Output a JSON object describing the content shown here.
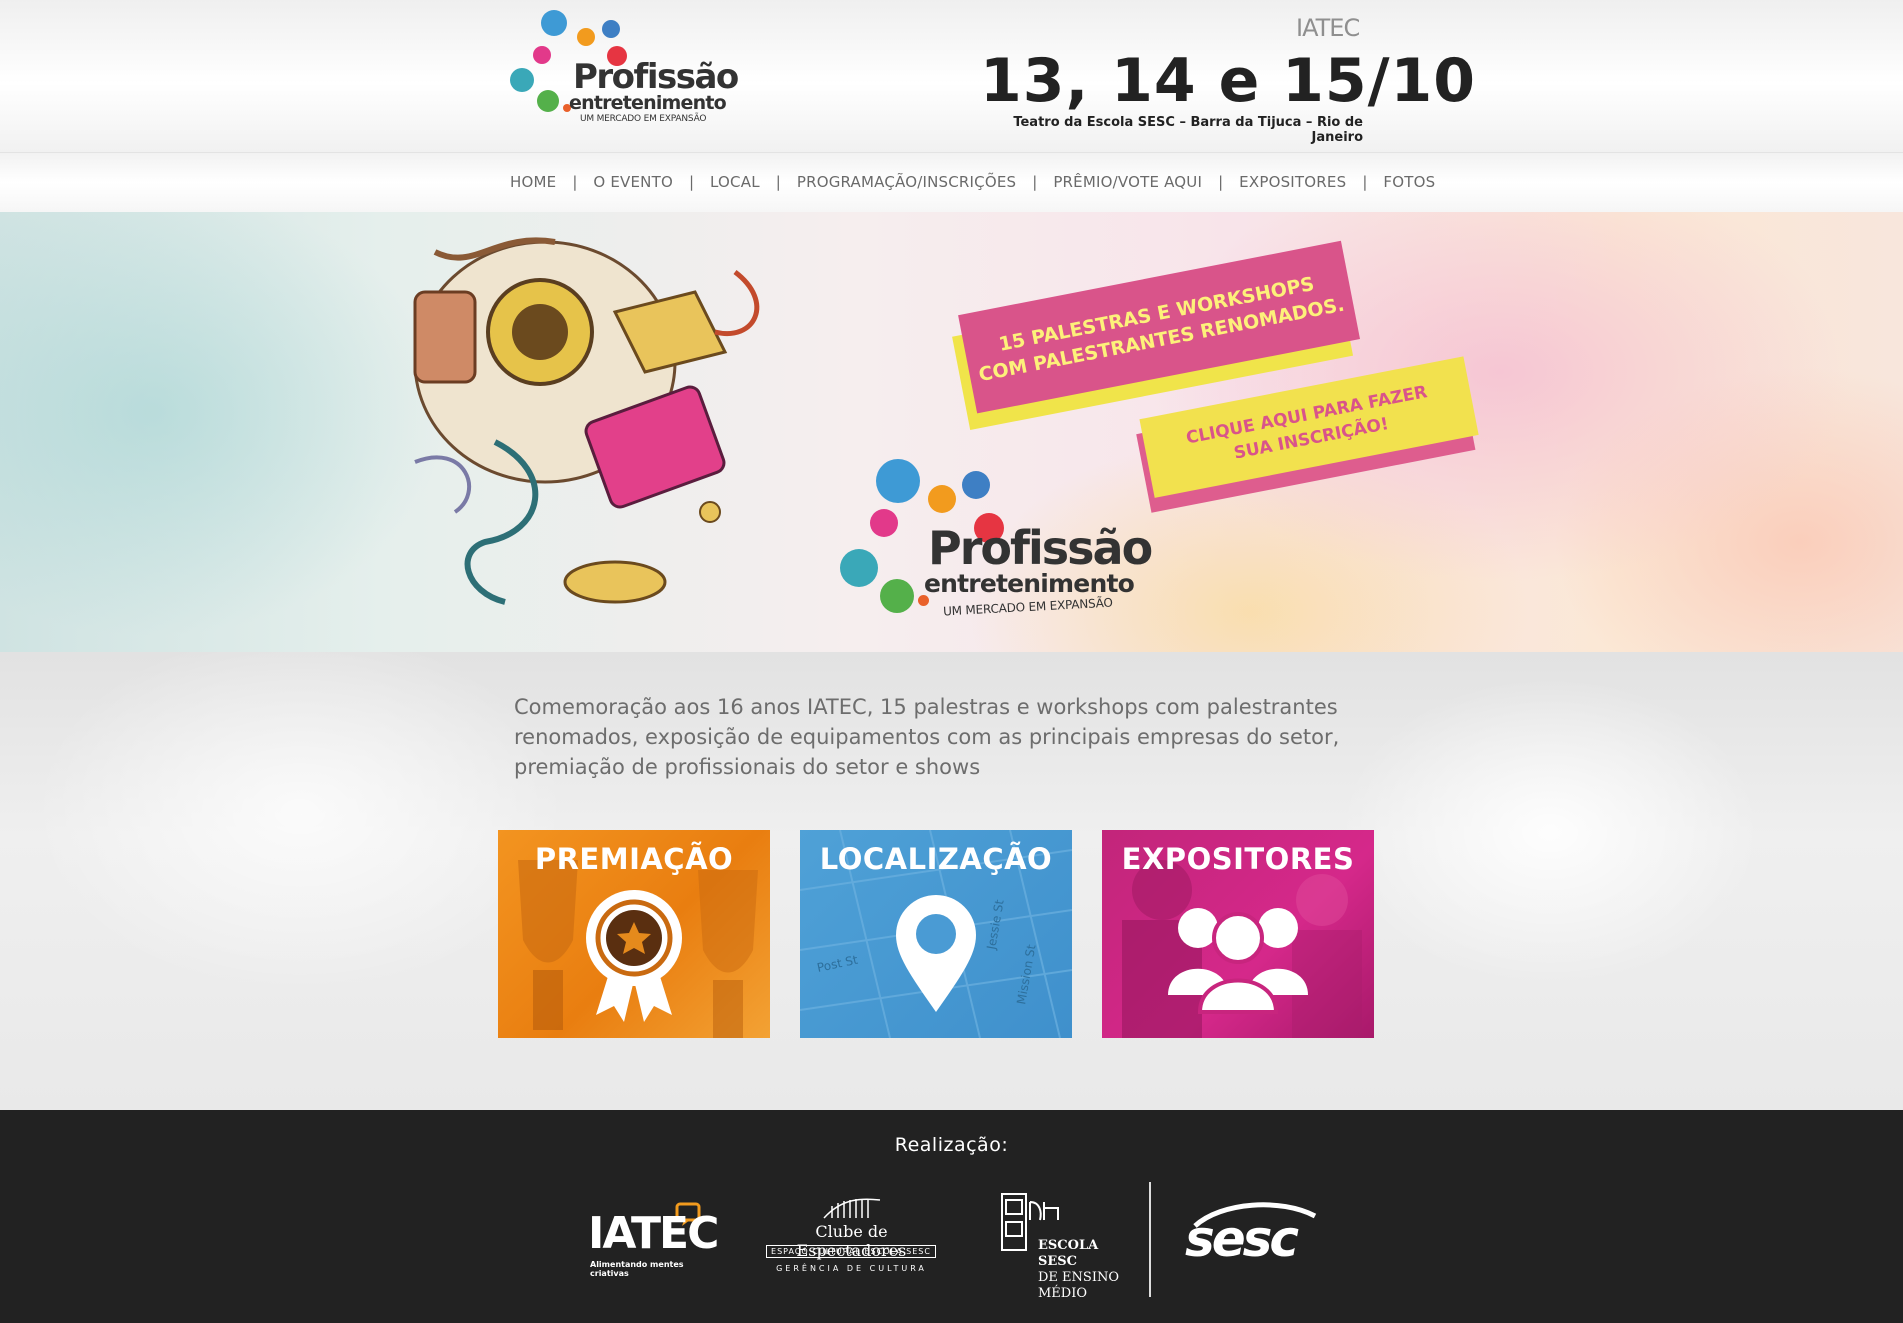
{
  "header": {
    "logo": {
      "word": "Profissão",
      "sub_dot": ".",
      "sub": "entretenimento",
      "tagline": "UM MERCADO EM EXPANSÃO"
    },
    "sponsor_small": {
      "name": "IATEC",
      "tagline": "Alimentando mentes criativas"
    },
    "dates": "13, 14 e 15/10",
    "venue": "Teatro da Escola SESC – Barra da Tijuca – Rio de Janeiro"
  },
  "nav": {
    "items": [
      {
        "label": "HOME"
      },
      {
        "label": "O EVENTO"
      },
      {
        "label": "LOCAL"
      },
      {
        "label": "PROGRAMAÇÃO/INSCRIÇÕES"
      },
      {
        "label": "PRÊMIO/VOTE AQUI"
      },
      {
        "label": "EXPOSITORES"
      },
      {
        "label": "FOTOS"
      }
    ],
    "separator": "|"
  },
  "banner": {
    "pink_line1": "15 PALESTRAS E WORKSHOPS",
    "pink_line2": "COM PALESTRANTES RENOMADOS.",
    "cta_line1": "CLIQUE AQUI PARA FAZER",
    "cta_line2": "SUA INSCRIÇÃO!",
    "logo": {
      "word": "Profissão",
      "sub_dot": ".",
      "sub": "entretenimento",
      "tagline": "UM MERCADO EM EXPANSÃO"
    }
  },
  "main": {
    "intro": "Comemoração aos 16 anos IATEC, 15 palestras e workshops com palestrantes renomados, exposição de equipamentos com as principais empresas do setor, premiação de profissionais do setor e shows",
    "cards": [
      {
        "title": "PREMIAÇÃO",
        "icon": "award-ribbon-icon",
        "color": "#f08a1c"
      },
      {
        "title": "LOCALIZAÇÃO",
        "icon": "map-pin-icon",
        "color": "#4a9bd4",
        "map_labels": [
          "Post St",
          "Mission St",
          "Jessie St"
        ]
      },
      {
        "title": "EXPOSITORES",
        "icon": "people-group-icon",
        "color": "#c8257e"
      }
    ]
  },
  "footer": {
    "heading": "Realização:",
    "logos": {
      "iatec": {
        "name": "IATEC",
        "tagline": "Alimentando mentes criativas"
      },
      "clube": {
        "title": "Clube de Espectadores",
        "line2": "ESPAÇO CULTURAL ESCOLA SESC",
        "line3": "GERÊNCIA DE CULTURA"
      },
      "escola": {
        "line1": "ESCOLA",
        "line2": "SESC",
        "line3": "DE ENSINO",
        "line4": "MÉDIO"
      },
      "sesc": {
        "name": "sesc"
      }
    }
  },
  "colors": {
    "orange": "#f08a1c",
    "blue": "#4a9bd4",
    "magenta": "#c8257e",
    "pink": "#d9548a",
    "yellow": "#f2e14e",
    "footer_bg": "#222222"
  }
}
